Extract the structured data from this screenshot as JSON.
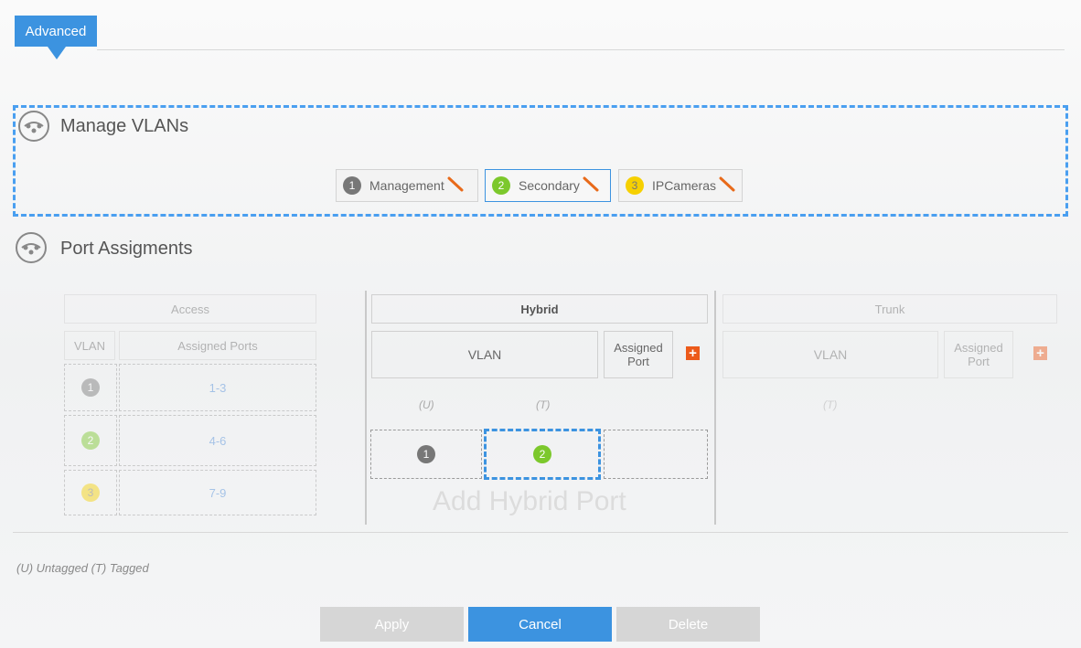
{
  "tab": {
    "label": "Advanced"
  },
  "manage": {
    "title": "Manage VLANs",
    "vlans": [
      {
        "number": "1",
        "name": "Management",
        "color": "#777777"
      },
      {
        "number": "2",
        "name": "Secondary",
        "color": "#7cc82c",
        "selected": true
      },
      {
        "number": "3",
        "name": "IPCameras",
        "color": "#f6d000"
      }
    ]
  },
  "ports": {
    "title": "Port Assigments",
    "access": {
      "header": "Access",
      "col_vlan": "VLAN",
      "col_ports": "Assigned Ports",
      "rows": [
        {
          "vlan": "1",
          "ports": "1-3"
        },
        {
          "vlan": "2",
          "ports": "4-6"
        },
        {
          "vlan": "3",
          "ports": "7-9"
        }
      ]
    },
    "hybrid": {
      "header": "Hybrid",
      "col_vlan": "VLAN",
      "col_port": "Assigned Port",
      "tag_u": "(U)",
      "tag_t": "(T)",
      "row": {
        "untagged": "1",
        "tagged": "2",
        "port": ""
      },
      "add_label": "Add Hybrid Port"
    },
    "trunk": {
      "header": "Trunk",
      "col_vlan": "VLAN",
      "col_port": "Assigned Port",
      "tag_t": "(T)"
    }
  },
  "legend": "(U) Untagged (T) Tagged",
  "buttons": {
    "apply": "Apply",
    "cancel": "Cancel",
    "delete": "Delete"
  },
  "colors": {
    "accent": "#3c93e0",
    "plus": "#ec5a1a"
  }
}
